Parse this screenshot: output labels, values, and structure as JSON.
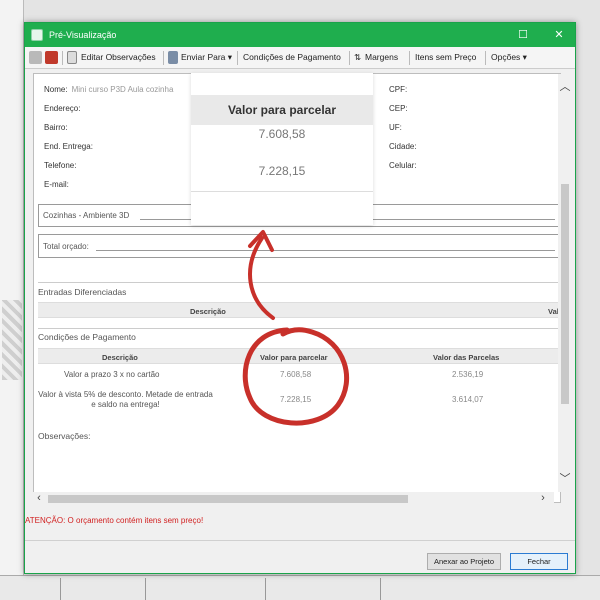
{
  "window": {
    "title": "Pré-Visualização"
  },
  "toolbar": {
    "editar": "Editar Observações",
    "enviar": "Enviar Para ▾",
    "condicoes": "Condições de Pagamento",
    "margens": "Margens",
    "itens": "Itens sem Preço",
    "opcoes": "Opções ▾"
  },
  "fields": {
    "nome_label": "Nome:",
    "nome_value": "Mini curso P3D Aula cozinha",
    "endereco": "Endereço:",
    "bairro": "Bairro:",
    "end_entrega": "End. Entrega:",
    "telefone": "Telefone:",
    "email": "E-mail:",
    "cpf": "CPF:",
    "cep": "CEP:",
    "uf": "UF:",
    "cidade": "Cidade:",
    "celular": "Celular:"
  },
  "items_box": {
    "label": "Cozinhas - Ambiente 3D"
  },
  "total_box": {
    "label": "Total orçado:"
  },
  "entradas": {
    "title": "Entradas Diferenciadas",
    "col_descricao": "Descrição",
    "col_valor": "Valo"
  },
  "condicoes": {
    "title": "Condições de Pagamento",
    "columns": [
      "Descrição",
      "Valor para parcelar",
      "Valor das Parcelas"
    ],
    "rows": [
      {
        "descricao": "Valor a prazo 3 x no cartão",
        "valor": "7.608,58",
        "parcelas": "2.536,19"
      },
      {
        "descricao": "Valor à vista 5% de desconto. Metade de entrada e saldo na entrega!",
        "valor": "7.228,15",
        "parcelas": "3.614,07"
      }
    ]
  },
  "observacoes": {
    "label": "Observações:"
  },
  "callout": {
    "title": "Valor para parcelar",
    "value1": "7.608,58",
    "value2": "7.228,15"
  },
  "warning": {
    "prefix": "ATENÇÃO:",
    "text": "O orçamento contém itens sem preço!"
  },
  "buttons": {
    "anexar": "Anexar ao Projeto",
    "fechar": "Fechar"
  },
  "colors": {
    "titlebar": "#1fae4e",
    "annotation": "#c8302a",
    "warning": "#d11f1f"
  }
}
